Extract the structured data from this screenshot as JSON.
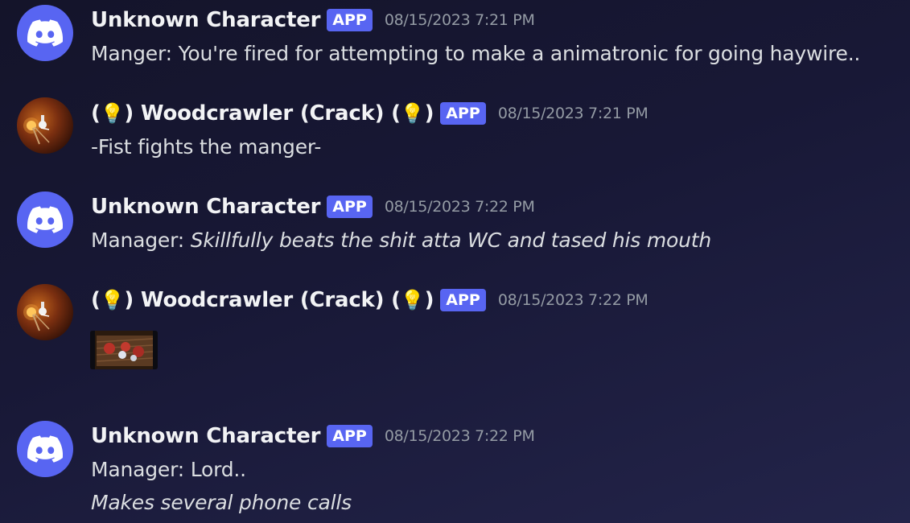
{
  "messages": [
    {
      "author": "Unknown Character",
      "badge": "APP",
      "timestamp": "08/15/2023 7:21 PM",
      "line1": "Manger: You're fired for attempting to make a animatronic for going haywire.."
    },
    {
      "author_prefix": "(",
      "author_mid": ") Woodcrawler (Crack) (",
      "author_suffix": ")",
      "bulb": "💡",
      "badge": "APP",
      "timestamp": "08/15/2023 7:21 PM",
      "line1": "-Fist fights the manger-"
    },
    {
      "author": "Unknown Character",
      "badge": "APP",
      "timestamp": "08/15/2023 7:22 PM",
      "line1_plain": "Manager: ",
      "line1_italic": "Skillfully beats the shit atta WC and tased his mouth"
    },
    {
      "author_prefix": "(",
      "author_mid": ") Woodcrawler (Crack) (",
      "author_suffix": ")",
      "bulb": "💡",
      "badge": "APP",
      "timestamp": "08/15/2023 7:22 PM",
      "attachment": "image-attachment"
    },
    {
      "author": "Unknown Character",
      "badge": "APP",
      "timestamp": "08/15/2023 7:22 PM",
      "line1": "Manager: Lord..",
      "line2_italic": "Makes several phone calls"
    }
  ],
  "icons": {
    "discord_avatar": "discord-logo-icon",
    "wood_avatar": "woodcrawler-avatar"
  },
  "colors": {
    "badge": "#5865f2",
    "username": "#f2f3f5",
    "timestamp": "#949ba4",
    "text": "#dbdee1"
  }
}
